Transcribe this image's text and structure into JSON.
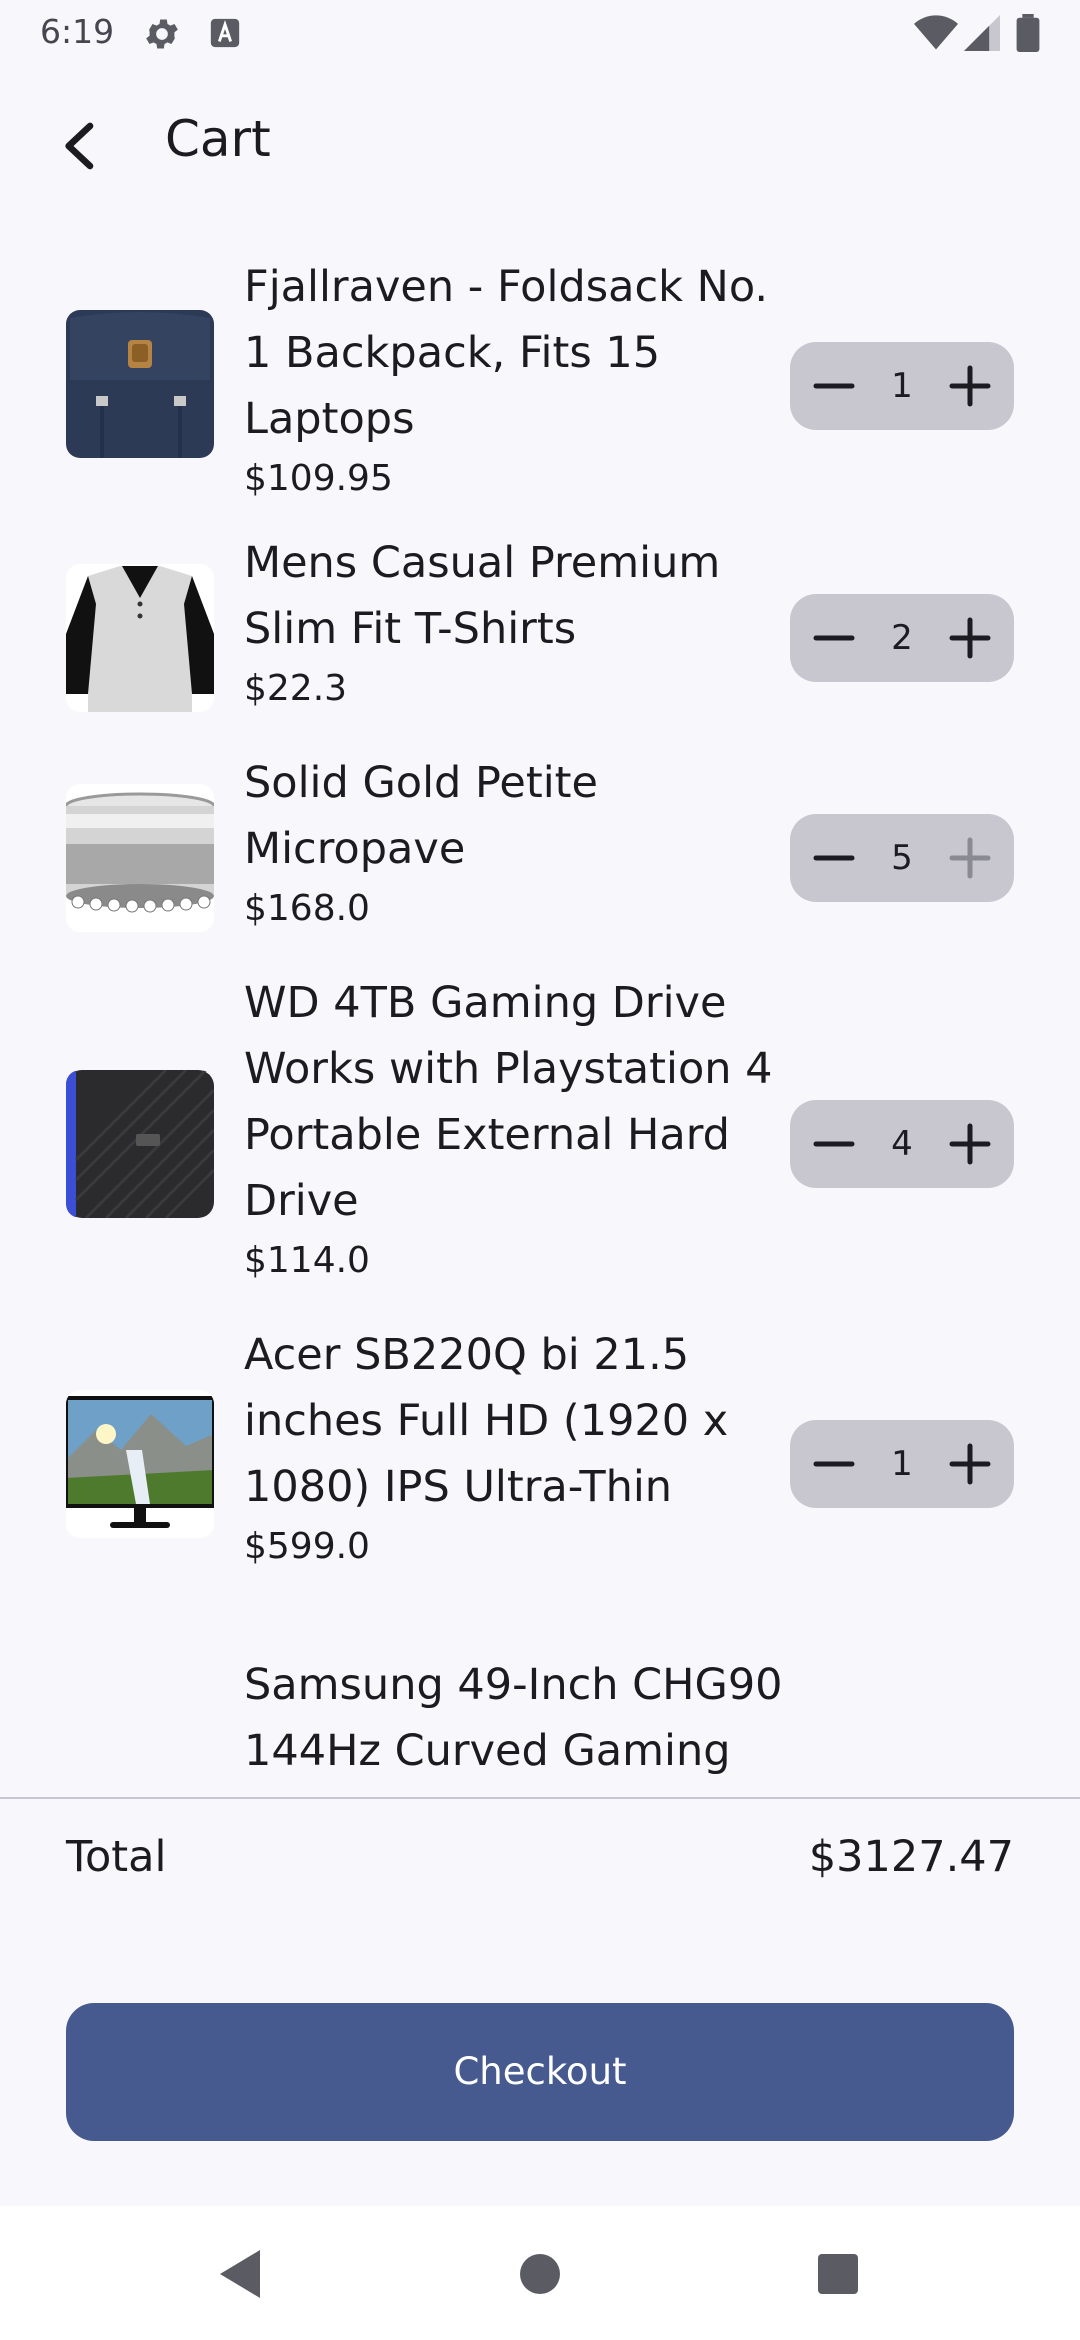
{
  "status_bar": {
    "time": "6:19",
    "icons": [
      "settings-icon",
      "a11y-icon",
      "wifi-icon",
      "signal-icon",
      "battery-icon"
    ]
  },
  "app_bar": {
    "back_icon": "back-arrow-icon",
    "title": "Cart"
  },
  "cart": {
    "items": [
      {
        "name": "Fjallraven - Foldsack No. 1 Backpack, Fits 15 Laptops",
        "price": "$109.95",
        "quantity": "1",
        "image": "backpack",
        "plus_enabled": true
      },
      {
        "name": "Mens Casual Premium Slim Fit T-Shirts",
        "price": "$22.3",
        "quantity": "2",
        "image": "tshirt",
        "plus_enabled": true
      },
      {
        "name": "Solid Gold Petite Micropave",
        "price": "$168.0",
        "quantity": "5",
        "image": "ring",
        "plus_enabled": false
      },
      {
        "name": "WD 4TB Gaming Drive Works with Playstation 4 Portable External Hard Drive",
        "price": "$114.0",
        "quantity": "4",
        "image": "hard-drive",
        "plus_enabled": true
      },
      {
        "name": "Acer SB220Q bi 21.5 inches Full HD (1920 x 1080) IPS Ultra-Thin",
        "price": "$599.0",
        "quantity": "1",
        "image": "monitor",
        "plus_enabled": true
      },
      {
        "name": "Samsung 49-Inch CHG90 144Hz Curved Gaming",
        "price": "",
        "quantity": "",
        "image": "",
        "plus_enabled": true
      }
    ]
  },
  "summary": {
    "total_label": "Total",
    "total_value": "$3127.47"
  },
  "checkout": {
    "label": "Checkout"
  },
  "colors": {
    "background": "#f8f7fc",
    "stepper_bg": "#c8c7cf",
    "primary": "#465a90",
    "text": "#1b1b21",
    "divider": "#c6c5d0"
  }
}
